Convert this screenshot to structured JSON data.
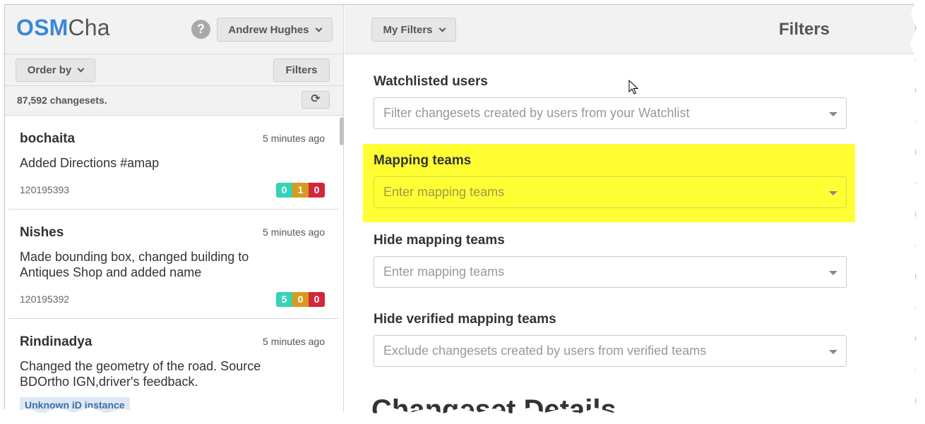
{
  "logo": {
    "part_a": "OSM",
    "part_b": "Cha"
  },
  "header": {
    "help_glyph": "?",
    "user_menu_label": "Andrew Hughes",
    "my_filters_label": "My Filters",
    "panel_title": "Filters"
  },
  "toolbar": {
    "order_by_label": "Order by",
    "filters_label": "Filters"
  },
  "changesets": {
    "count_text": "87,592 changesets.",
    "refresh_glyph": "⟳",
    "items": [
      {
        "user": "bochaita",
        "time": "5 minutes ago",
        "comment": "Added Directions #amap",
        "id": "120195393",
        "create": "0",
        "modify": "1",
        "delete": "0"
      },
      {
        "user": "Nishes",
        "time": "5 minutes ago",
        "comment": "Made bounding box, changed building to Antiques Shop and added name",
        "id": "120195392",
        "create": "5",
        "modify": "0",
        "delete": "0"
      },
      {
        "user": "Rindinadya",
        "time": "5 minutes ago",
        "comment": "Changed the geometry of the road. Source BDOrtho IGN,driver's feedback.",
        "tag": "Unknown iD instance"
      }
    ]
  },
  "filters": {
    "watchlisted": {
      "label": "Watchlisted users",
      "placeholder": "Filter changesets created by users from your Watchlist"
    },
    "mapping_teams": {
      "label": "Mapping teams",
      "placeholder": "Enter mapping teams"
    },
    "hide_mapping_teams": {
      "label": "Hide mapping teams",
      "placeholder": "Enter mapping teams"
    },
    "hide_verified": {
      "label": "Hide verified mapping teams",
      "placeholder": "Exclude changesets created by users from verified teams"
    }
  },
  "section": {
    "changeset_details_title": "Changeset Details"
  },
  "colors": {
    "logo_blue": "#3b88d8",
    "highlight": "#ffff33",
    "badge_create": "#39d2b6",
    "badge_modify": "#d69a1f",
    "badge_delete": "#d3273a"
  }
}
